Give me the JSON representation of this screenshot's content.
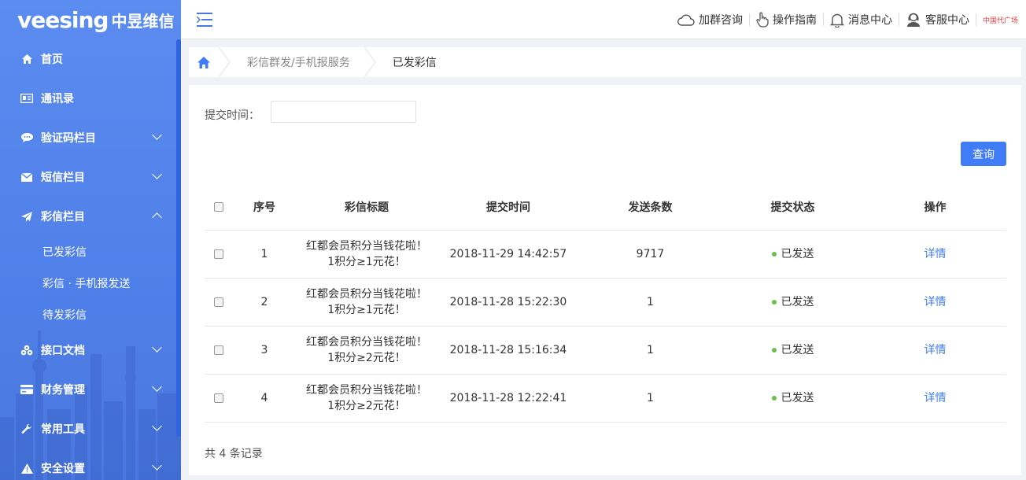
{
  "logo": {
    "brand": "veesing",
    "cn": "中昱维信"
  },
  "sidebar": {
    "items": [
      {
        "label": "首页",
        "icon": "home-icon"
      },
      {
        "label": "通讯录",
        "icon": "contact-card-icon"
      },
      {
        "label": "验证码栏目",
        "icon": "chat-bubble-icon",
        "arrow": "down"
      },
      {
        "label": "短信栏目",
        "icon": "envelope-icon",
        "arrow": "down"
      },
      {
        "label": "彩信栏目",
        "icon": "paper-plane-icon",
        "arrow": "up"
      }
    ],
    "subitems": [
      "已发彩信",
      "彩信 · 手机报发送",
      "待发彩信"
    ],
    "items_after": [
      {
        "label": "接口文档",
        "icon": "share-nodes-icon",
        "arrow": "down"
      },
      {
        "label": "财务管理",
        "icon": "credit-card-icon",
        "arrow": "down"
      },
      {
        "label": "常用工具",
        "icon": "wrench-icon",
        "arrow": "down"
      },
      {
        "label": "安全设置",
        "icon": "warning-icon",
        "arrow": "down"
      }
    ]
  },
  "header": {
    "actions": [
      {
        "label": "加群咨询",
        "icon": "cloud-chat-icon"
      },
      {
        "label": "操作指南",
        "icon": "hand-pointer-icon"
      },
      {
        "label": "消息中心",
        "icon": "bell-icon"
      },
      {
        "label": "客服中心",
        "icon": "support-agent-icon"
      }
    ],
    "mini_brand": "中国代广场"
  },
  "breadcrumb": {
    "parent": "彩信群发/手机报服务",
    "current": "已发彩信"
  },
  "filter": {
    "label": "提交时间：",
    "value": "",
    "placeholder": ""
  },
  "query_label": "查询",
  "table": {
    "headers": [
      "序号",
      "彩信标题",
      "提交时间",
      "发送条数",
      "提交状态",
      "操作"
    ],
    "rows": [
      {
        "no": "1",
        "title1": "红都会员积分当钱花啦！",
        "title2": "1积分≥1元花！",
        "time": "2018-11-29 14:42:57",
        "count": "9717",
        "status": "已发送",
        "action": "详情"
      },
      {
        "no": "2",
        "title1": "红都会员积分当钱花啦！",
        "title2": "1积分≥1元花！",
        "time": "2018-11-28 15:22:30",
        "count": "1",
        "status": "已发送",
        "action": "详情"
      },
      {
        "no": "3",
        "title1": "红都会员积分当钱花啦！",
        "title2": "1积分≥2元花！",
        "time": "2018-11-28 15:16:34",
        "count": "1",
        "status": "已发送",
        "action": "详情"
      },
      {
        "no": "4",
        "title1": "红都会员积分当钱花啦！",
        "title2": "1积分≥2元花！",
        "time": "2018-11-28 12:22:41",
        "count": "1",
        "status": "已发送",
        "action": "详情"
      }
    ]
  },
  "footer_count": "共 4 条记录",
  "colors": {
    "sidebar": "#5b8cf0",
    "accent": "#3f7cf5",
    "status_ok": "#6cc04a"
  }
}
